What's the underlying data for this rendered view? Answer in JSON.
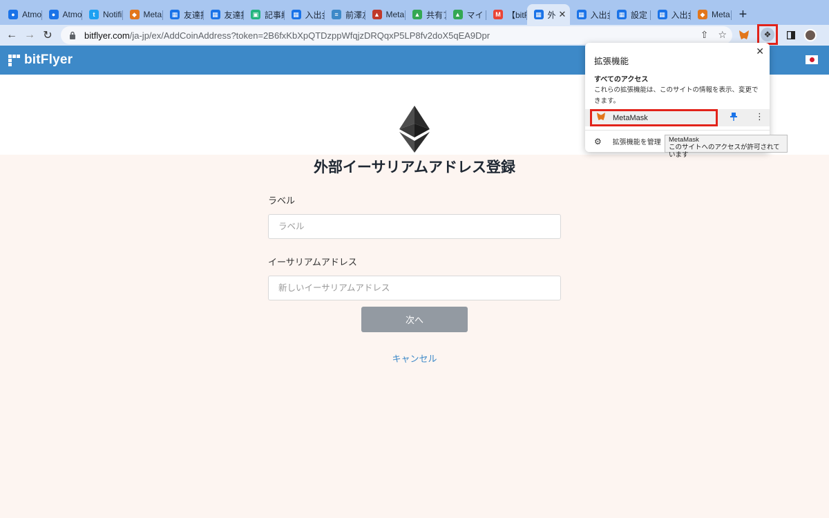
{
  "browser": {
    "tabs": [
      {
        "label": "Atmo",
        "color": "#1a73e8",
        "glyph": "●"
      },
      {
        "label": "Atmo",
        "color": "#1a73e8",
        "glyph": "●"
      },
      {
        "label": "Notifi",
        "color": "#1da1f2",
        "glyph": "t"
      },
      {
        "label": "Meta",
        "color": "#e2761b",
        "glyph": "◆"
      },
      {
        "label": "友達招",
        "color": "#1a73e8",
        "glyph": "▦"
      },
      {
        "label": "友達招",
        "color": "#1a73e8",
        "glyph": "▦"
      },
      {
        "label": "記事編",
        "color": "#24b47e",
        "glyph": "▣"
      },
      {
        "label": "入出金",
        "color": "#1a73e8",
        "glyph": "▦"
      },
      {
        "label": "前澤友",
        "color": "#3d89c8",
        "glyph": "≡"
      },
      {
        "label": "Meta",
        "color": "#c0392b",
        "glyph": "▲"
      },
      {
        "label": "共有ア",
        "color": "#34a853",
        "glyph": "▲"
      },
      {
        "label": "マイド",
        "color": "#34a853",
        "glyph": "▲"
      },
      {
        "label": "【bitF",
        "color": "#ea4335",
        "glyph": "M"
      },
      {
        "label": "外",
        "color": "#1a73e8",
        "glyph": "▦",
        "active": true
      },
      {
        "label": "入出金",
        "color": "#1a73e8",
        "glyph": "▦"
      },
      {
        "label": "設定 |",
        "color": "#1a73e8",
        "glyph": "▦"
      },
      {
        "label": "入出金",
        "color": "#1a73e8",
        "glyph": "▦"
      },
      {
        "label": "Meta",
        "color": "#e2761b",
        "glyph": "◆"
      }
    ],
    "url_host": "bitflyer.com",
    "url_path": "/ja-jp/ex/AddCoinAddress?token=2B6fxKbXpQTDzppWfqjzDRQqxP5LP8fv2doX5qEA9Dpr"
  },
  "site": {
    "logo": "bitFlyer"
  },
  "main": {
    "title": "外部イーサリアムアドレス登録",
    "label_field": {
      "label": "ラベル",
      "placeholder": "ラベル"
    },
    "address_field": {
      "label": "イーサリアムアドレス",
      "placeholder": "新しいイーサリアムアドレス"
    },
    "next_label": "次へ",
    "cancel_label": "キャンセル"
  },
  "extensions_popup": {
    "title": "拡張機能",
    "section_title": "すべてのアクセス",
    "section_desc": "これらの拡張機能は、このサイトの情報を表示、変更できます。",
    "item_name": "MetaMask",
    "manage_label": "拡張機能を管理",
    "tooltip_title": "MetaMask",
    "tooltip_desc": "このサイトへのアクセスが許可されています"
  },
  "colors": {
    "header_blue": "#3d89c8",
    "highlight_red": "#e2231a",
    "page_bg": "#fdf5f1"
  }
}
